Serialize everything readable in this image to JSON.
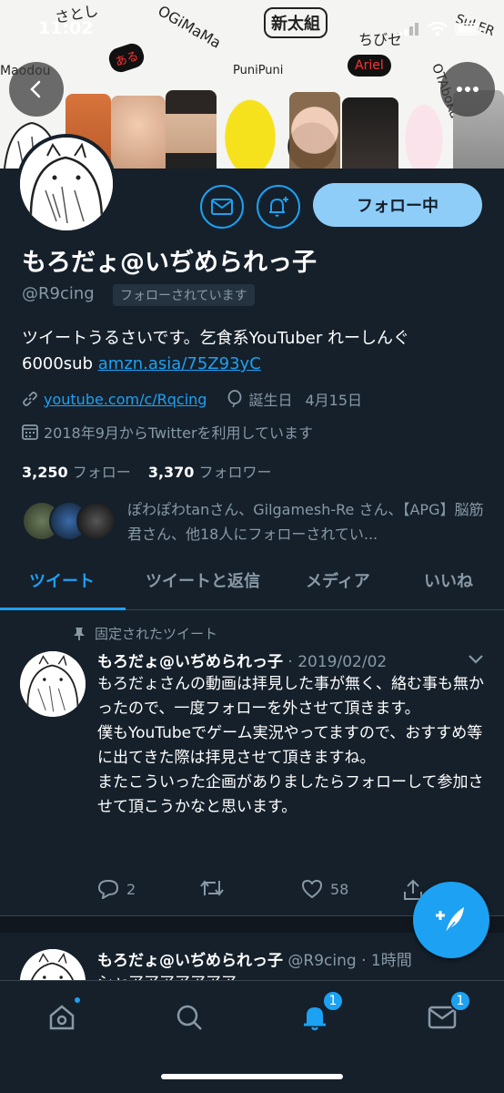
{
  "status_bar": {
    "time": "11:02"
  },
  "banner": {
    "doodle_texts": [
      "さとし",
      "OGiMaMa",
      "新太組",
      "ちびゼ",
      "SuLER",
      "Maodou",
      "ある",
      "PuniPuni",
      "Ariel",
      "OTAboKu"
    ]
  },
  "profile": {
    "name": "もろだょ@いぢめられっ子",
    "handle": "@R9cing",
    "follows_you": "フォローされています",
    "follow_button": "フォロー中",
    "bio_text": "ツイートうるさいです。乞食系YouTuber れーしんぐ6000sub ",
    "bio_link": "amzn.asia/75Z93yC",
    "website": "youtube.com/c/Rqcing",
    "birthday_label": "誕生日",
    "birthday": "4月15日",
    "joined": "2018年9月からTwitterを利用しています",
    "following_count": "3,250",
    "following_label": "フォロー",
    "followers_count": "3,370",
    "followers_label": "フォロワー",
    "followed_by": "ぽわぽわtanさん、Gilgamesh-Re さん、【APG】脳筋君さん、他18人にフォローされてい..."
  },
  "tabs": [
    {
      "label": "ツイート"
    },
    {
      "label": "ツイートと返信"
    },
    {
      "label": "メディア"
    },
    {
      "label": "いいね"
    }
  ],
  "pinned_tweet": {
    "pinned_label": "固定されたツイート",
    "name": "もろだょ@いぢめられっ子",
    "date": "· 2019/02/02",
    "body": "もろだょさんの動画は拝見した事が無く、絡む事も無かったので、一度フォローを外させて頂きます。\n僕もYouTubeでゲーム実況やってますので、おすすめ等に出てきた際は拝見させて頂きますね。\nまたこういった企画がありましたらフォローして参加させて頂こうかなと思います。",
    "replies": "2",
    "likes": "58"
  },
  "second_tweet": {
    "name": "もろだょ@いぢめられっ子",
    "handle_time": "@R9cing · 1時間",
    "body_partial": "シャアアアアアアア"
  },
  "bottom_nav": {
    "notifications_badge": "1",
    "messages_badge": "1"
  },
  "colors": {
    "accent": "#1da1f2",
    "background": "#15202b",
    "muted": "#8899a6"
  }
}
